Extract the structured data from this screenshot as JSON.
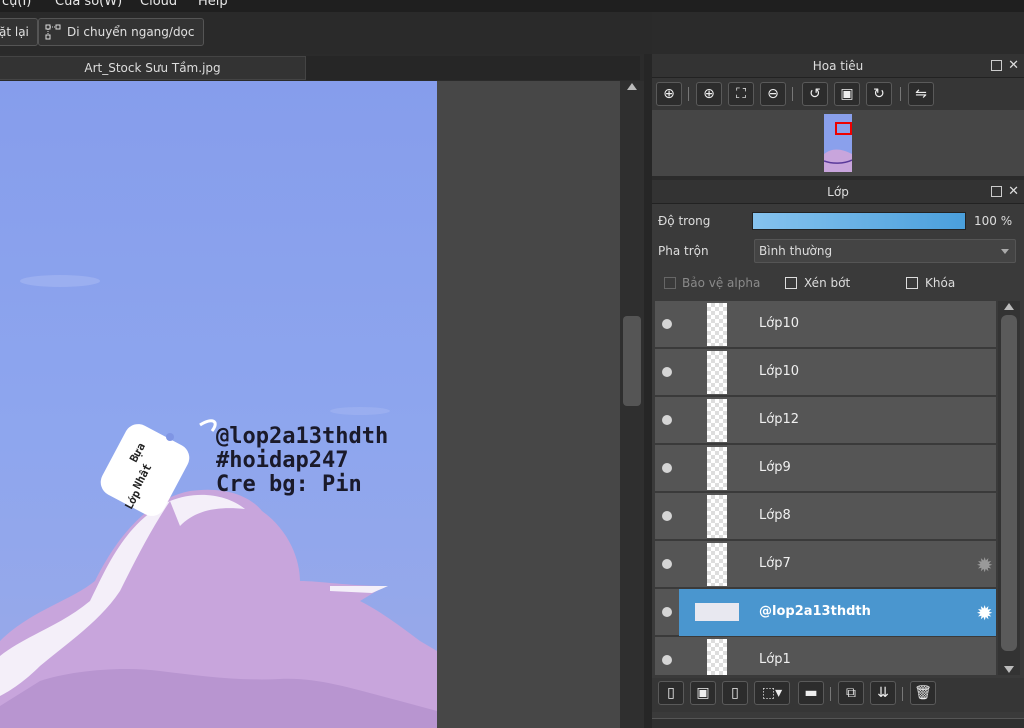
{
  "menu": {
    "items": [
      "cụ(I)",
      "Cửa sổ(W)",
      "Cloud",
      "Help"
    ]
  },
  "toolbar": {
    "reset_label": "ặt lại",
    "scroll_mode_label": "Di chuyển ngang/dọc"
  },
  "document": {
    "tab_title": "Art_Stock Sưu Tầm.jpg"
  },
  "artwork": {
    "caption_lines": [
      "@lop2a13thdth",
      "#hoidap247",
      "Cre bg: Pin"
    ],
    "tag_text": [
      "Bựa",
      "Nhất",
      "Lớp"
    ],
    "colors": {
      "sky": "#8aa0ec",
      "cloud": "#c9a6dc",
      "cloud_light": "#f3eef9"
    }
  },
  "navigator": {
    "title": "Hoa tiêu",
    "tools": [
      "zoom-fit-icon",
      "zoom-in-icon",
      "fit-screen-icon",
      "zoom-out-icon",
      "rotate-left-icon",
      "fit-window-icon",
      "rotate-right-icon",
      "flip-icon"
    ]
  },
  "layers_panel": {
    "title": "Lớp",
    "opacity_label": "Độ trong",
    "opacity_value": "100 %",
    "opacity_fraction": 1.0,
    "blend_label": "Pha trộn",
    "blend_value": "Bình thường",
    "protect_alpha_label": "Bảo vệ alpha",
    "clipping_label": "Xén bớt",
    "lock_label": "Khóa",
    "layers": [
      {
        "name": "Lớp10",
        "selected": false,
        "gear": false
      },
      {
        "name": "Lớp10",
        "selected": false,
        "gear": false
      },
      {
        "name": "Lớp12",
        "selected": false,
        "gear": false
      },
      {
        "name": "Lớp9",
        "selected": false,
        "gear": false
      },
      {
        "name": "Lớp8",
        "selected": false,
        "gear": false
      },
      {
        "name": "Lớp7",
        "selected": false,
        "gear": true
      },
      {
        "name": "@lop2a13thdth",
        "selected": true,
        "gear": true
      },
      {
        "name": "Lớp1",
        "selected": false,
        "gear": false
      }
    ],
    "accent_color": "#4a96cf"
  }
}
